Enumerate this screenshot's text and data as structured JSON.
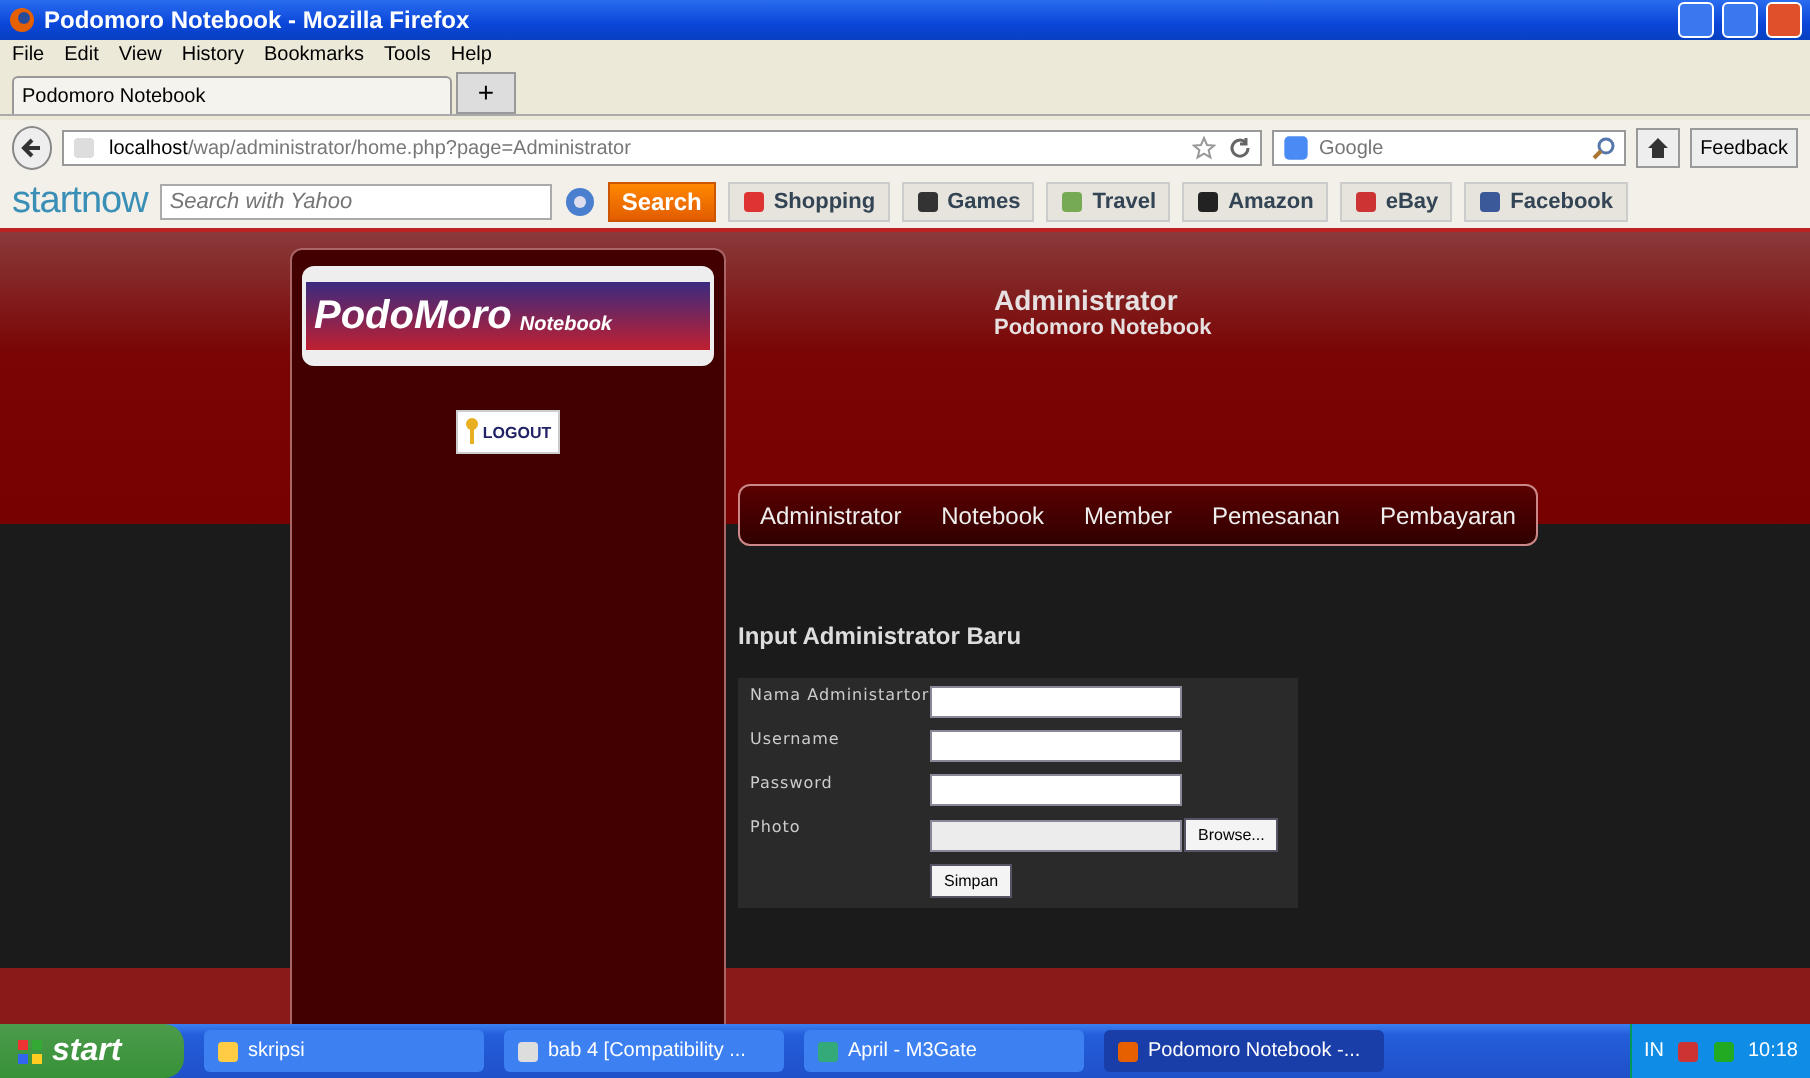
{
  "window": {
    "title": "Podomoro Notebook - Mozilla Firefox"
  },
  "menu": [
    "File",
    "Edit",
    "View",
    "History",
    "Bookmarks",
    "Tools",
    "Help"
  ],
  "tabs": [
    {
      "label": "Podomoro Notebook",
      "selected": true
    }
  ],
  "tab_add": "+",
  "address": {
    "url": "**localhost**/wap/administrator/home.php?page=Administrator"
  },
  "search": {
    "placeholder": "Google"
  },
  "feedback": "Feedback",
  "startnow": {
    "logo": "startnow",
    "placeholder": "Search with Yahoo",
    "button": "Search",
    "bookmarks": [
      "Shopping",
      "Games",
      "Travel",
      "Amazon",
      "eBay",
      "Facebook"
    ]
  },
  "page": {
    "logo": {
      "main": "PodoMoro",
      "sub": "Notebook"
    },
    "logout": "LOGOUT",
    "header": {
      "title": "Administrator",
      "subtitle": "Podomoro Notebook"
    },
    "nav": [
      "Administrator",
      "Notebook",
      "Member",
      "Pemesanan",
      "Pembayaran"
    ],
    "form": {
      "heading": "Input Administrator Baru",
      "fields": [
        {
          "label": "Nama Administartor",
          "kind": "text"
        },
        {
          "label": "Username",
          "kind": "text"
        },
        {
          "label": "Password",
          "kind": "text"
        },
        {
          "label": "Photo",
          "kind": "file",
          "button": "Browse..."
        }
      ],
      "submit": "Simpan"
    }
  },
  "taskbar": {
    "start": "start",
    "items": [
      {
        "label": "skripsi",
        "selected": false
      },
      {
        "label": "bab 4 [Compatibility ...",
        "selected": false
      },
      {
        "label": "April - M3Gate",
        "selected": false
      },
      {
        "label": "Podomoro Notebook -...",
        "selected": true
      }
    ],
    "lang": "IN",
    "clock": "10:18"
  }
}
